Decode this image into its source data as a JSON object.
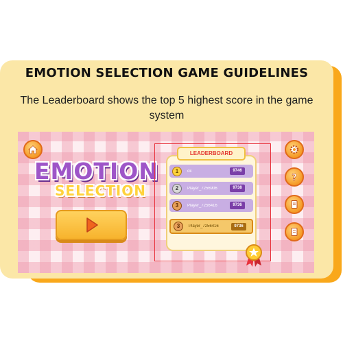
{
  "guideline": {
    "title": "EMOTION SELECTION GAME GUIDELINES",
    "description": "The Leaderboard shows the top 5 highest score in the game system"
  },
  "game": {
    "logo_line1": "EMOTION",
    "logo_line2": "SELECTION",
    "icons": {
      "home": "home-icon",
      "play": "play-icon",
      "settings": "gear-icon",
      "help": "question-icon",
      "book1": "book-icon",
      "book2": "book-icon",
      "medal": "medal-icon"
    },
    "colors": {
      "logo_purple": "#9e55c8",
      "logo_yellow": "#ffd23c",
      "button_orange": "#f59a26",
      "highlight_red": "#e8323c"
    }
  },
  "leaderboard": {
    "title": "LEADERBOARD",
    "rows": [
      {
        "rank": "1",
        "name": "ok",
        "score": "9746"
      },
      {
        "rank": "2",
        "name": "Player_7256906",
        "score": "9738"
      },
      {
        "rank": "3",
        "name": "Player_7256416",
        "score": "9736"
      }
    ],
    "current_player": {
      "rank": "3",
      "name": "Player_7256416",
      "score": "9736"
    }
  }
}
